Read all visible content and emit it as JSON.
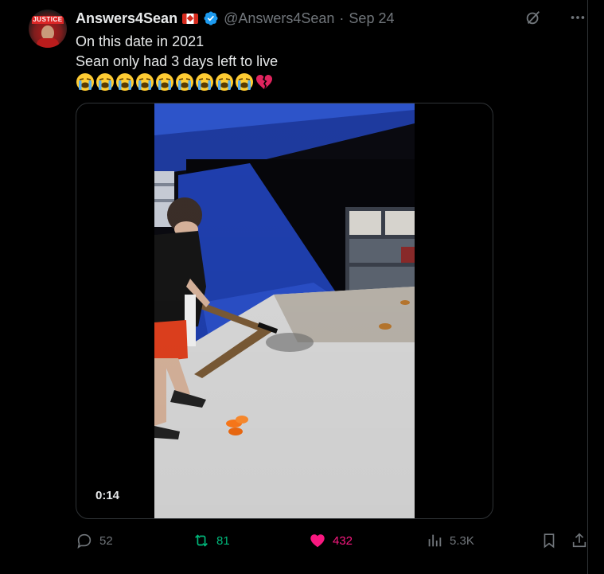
{
  "tweet": {
    "author_name": "Answers4Sean",
    "handle": "@Answers4Sean",
    "separator": "·",
    "date": "Sep 24",
    "text_line1": "On this date in 2021",
    "text_line2": "Sean only had 3 days left to live",
    "emojis": [
      "loudly-crying-face",
      "loudly-crying-face",
      "loudly-crying-face",
      "loudly-crying-face",
      "loudly-crying-face",
      "loudly-crying-face",
      "loudly-crying-face",
      "loudly-crying-face",
      "loudly-crying-face",
      "broken-heart"
    ],
    "avatar_badge": "JUSTICE"
  },
  "media": {
    "type": "video",
    "duration": "0:14"
  },
  "actions": {
    "replies": "52",
    "reposts": "81",
    "likes": "432",
    "views": "5.3K"
  },
  "colors": {
    "background": "#000000",
    "text": "#e7e9ea",
    "muted": "#71767b",
    "repost_active": "#00ba7c",
    "like_active": "#f91880",
    "verified": "#1d9bf0"
  }
}
